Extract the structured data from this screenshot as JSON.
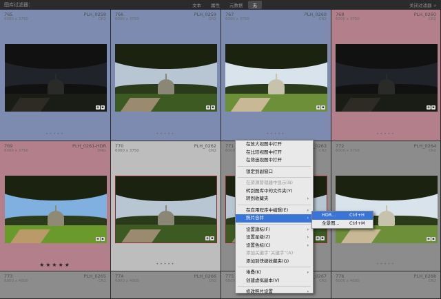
{
  "filter_bar": {
    "left_label": "图库过滤器：",
    "tabs": [
      "文本",
      "属性",
      "元数据",
      "无"
    ],
    "active_tab": 3,
    "right_label": "关闭过滤器 ÷"
  },
  "cells": [
    {
      "index": "765",
      "dims": "6000 x 3750",
      "name": "PLH_0258",
      "ext": "CR2",
      "bg": "#7d8bb0",
      "photo": "dark"
    },
    {
      "index": "766",
      "dims": "6000 x 3750",
      "name": "PLH_0259",
      "ext": "CR2",
      "bg": "#7d8bb0",
      "photo": "normal"
    },
    {
      "index": "767",
      "dims": "6000 x 3750",
      "name": "PLH_0260",
      "ext": "CR2",
      "bg": "#7d8bb0",
      "photo": "bright"
    },
    {
      "index": "768",
      "dims": "6000 x 3750",
      "name": "PLH_0260",
      "ext": "CR2",
      "bg": "#b37f8b",
      "photo": "dark"
    },
    {
      "index": "769",
      "dims": "6000 x 3750",
      "name": "PLH_0261-HDR",
      "ext": "DNG",
      "bg": "#b37f8b",
      "photo": "hdr",
      "stars": "★★★★★"
    },
    {
      "index": "770",
      "dims": "6000 x 3750",
      "name": "PLH_0262",
      "ext": "CR2",
      "bg": "#bdbdbd",
      "photo": "normal"
    },
    {
      "index": "771",
      "dims": "6000 x 3750",
      "name": "PLH_0263",
      "ext": "CR2",
      "bg": "#8c8c8c",
      "photo": "normal"
    },
    {
      "index": "772",
      "dims": "6000 x 3750",
      "name": "PLH_0264",
      "ext": "CR2",
      "bg": "#8c8c8c",
      "photo": "bright"
    },
    {
      "index": "773",
      "dims": "6000 x 4000",
      "name": "PLH_0265",
      "ext": "CR2",
      "bg": "#8c8c8c",
      "photo": "none"
    },
    {
      "index": "774",
      "dims": "6000 x 4000",
      "name": "PLH_0266",
      "ext": "CR2",
      "bg": "#8c8c8c",
      "photo": "none"
    },
    {
      "index": "775",
      "dims": "6000 x 4000",
      "name": "PLH_0267",
      "ext": "CR2",
      "bg": "#8c8c8c",
      "photo": "none"
    },
    {
      "index": "776",
      "dims": "6000 x 4000",
      "name": "PLH_0268",
      "ext": "CR2",
      "bg": "#8c8c8c",
      "photo": "none"
    }
  ],
  "context_menu": {
    "items": [
      {
        "label": "在放大视图中打开",
        "state": "normal"
      },
      {
        "label": "在比较视图中打开",
        "state": "normal"
      },
      {
        "label": "在筛选视图中打开",
        "state": "normal"
      },
      {
        "sep": true
      },
      {
        "label": "锁定到副窗口",
        "state": "normal"
      },
      {
        "sep": true
      },
      {
        "label": "在资源管理器中显示(B)",
        "state": "disabled"
      },
      {
        "label": "转到图库中的文件夹(Y)",
        "state": "normal"
      },
      {
        "label": "转到收藏夹",
        "state": "normal",
        "arrow": true
      },
      {
        "sep": true
      },
      {
        "label": "在应用程序中编辑(E)",
        "state": "normal",
        "arrow": true
      },
      {
        "label": "照片合并",
        "state": "highlight",
        "arrow": true
      },
      {
        "sep": true
      },
      {
        "label": "设置旗标(F)",
        "state": "normal",
        "arrow": true
      },
      {
        "label": "设置星级(Z)",
        "state": "normal",
        "arrow": true
      },
      {
        "label": "设置色标(C)",
        "state": "normal",
        "arrow": true
      },
      {
        "label": "添加关键字“关键字”(A)",
        "state": "disabled"
      },
      {
        "label": "添加到快捷收藏夹(Q)",
        "state": "normal"
      },
      {
        "sep": true
      },
      {
        "label": "堆叠(K)",
        "state": "normal",
        "arrow": true
      },
      {
        "label": "创建虚拟副本(V)",
        "state": "normal"
      },
      {
        "sep": true
      },
      {
        "label": "修改照片设置",
        "state": "normal",
        "arrow": true
      }
    ]
  },
  "submenu": {
    "items": [
      {
        "label": "HDR...",
        "shortcut": "Ctrl+H",
        "state": "highlight"
      },
      {
        "label": "全景图...",
        "shortcut": "Ctrl+M",
        "state": "normal"
      }
    ]
  },
  "colors": {
    "menu_highlight": "#3875d7",
    "blue_label": "#7d8bb0",
    "red_label": "#b37f8b",
    "selected_cell": "#bdbdbd"
  }
}
